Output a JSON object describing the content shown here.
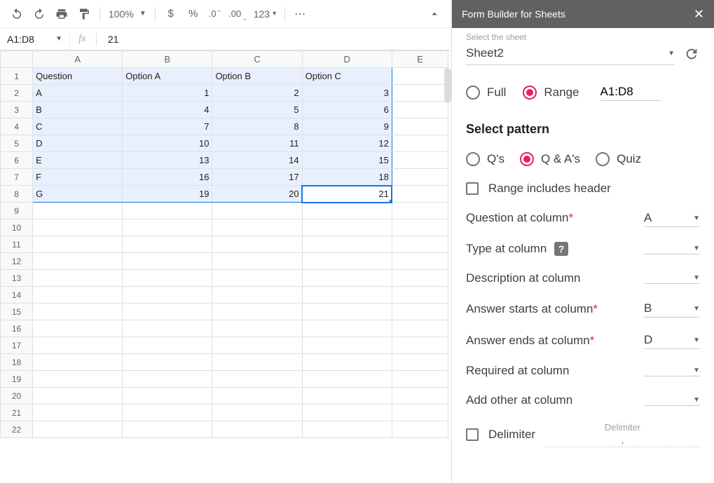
{
  "toolbar": {
    "zoom": "100%",
    "numfmt": "123"
  },
  "formula_bar": {
    "name_box": "A1:D8",
    "fx_label": "fx",
    "value": "21"
  },
  "grid": {
    "col_headers": [
      "A",
      "B",
      "C",
      "D",
      "E"
    ],
    "row_count": 22,
    "selection": "A1:D8",
    "active_cell": "D8",
    "rows": [
      {
        "A": "Question",
        "B": "Option A",
        "C": "Option B",
        "D": "Option C"
      },
      {
        "A": "A",
        "B": "1",
        "C": "2",
        "D": "3"
      },
      {
        "A": "B",
        "B": "4",
        "C": "5",
        "D": "6"
      },
      {
        "A": "C",
        "B": "7",
        "C": "8",
        "D": "9"
      },
      {
        "A": "D",
        "B": "10",
        "C": "11",
        "D": "12"
      },
      {
        "A": "E",
        "B": "13",
        "C": "14",
        "D": "15"
      },
      {
        "A": "F",
        "B": "16",
        "C": "17",
        "D": "18"
      },
      {
        "A": "G",
        "B": "19",
        "C": "20",
        "D": "21"
      }
    ]
  },
  "sidebar": {
    "title": "Form Builder for Sheets",
    "select_sheet_label": "Select the sheet",
    "sheet_value": "Sheet2",
    "range_radio": {
      "full": "Full",
      "range": "Range",
      "selected": "Range",
      "range_value": "A1:D8"
    },
    "pattern_title": "Select pattern",
    "pattern": {
      "qs": "Q's",
      "qa": "Q & A's",
      "quiz": "Quiz",
      "selected": "Q & A's"
    },
    "header_checkbox_label": "Range includes header",
    "fields": {
      "question": {
        "label": "Question at column",
        "required": true,
        "value": "A"
      },
      "type": {
        "label": "Type at column",
        "help": "?",
        "value": ""
      },
      "description": {
        "label": "Description at column",
        "value": ""
      },
      "answer_start": {
        "label": "Answer starts at column",
        "required": true,
        "value": "B"
      },
      "answer_end": {
        "label": "Answer ends at column",
        "required": true,
        "value": "D"
      },
      "required_col": {
        "label": "Required at column",
        "value": ""
      },
      "add_other": {
        "label": "Add other at column",
        "value": ""
      }
    },
    "delimiter": {
      "checkbox_label": "Delimiter",
      "hint_label": "Delimiter",
      "value": ","
    }
  }
}
